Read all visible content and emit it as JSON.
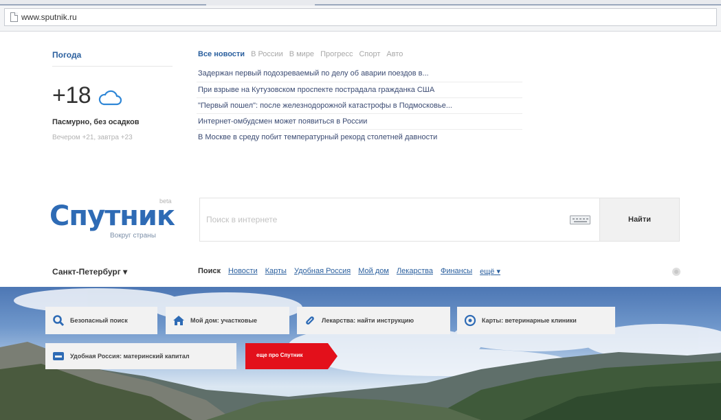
{
  "browser": {
    "url": "www.sputnik.ru"
  },
  "weather": {
    "title": "Погода",
    "temperature": "+18",
    "condition_icon": "cloud-icon",
    "description": "Пасмурно, без осадков",
    "forecast": "Вечером +21, завтра +23"
  },
  "news": {
    "tabs": [
      "Все новости",
      "В России",
      "В мире",
      "Прогресс",
      "Спорт",
      "Авто"
    ],
    "active_tab": "Все новости",
    "items": [
      "Задержан первый подозреваемый по делу об аварии поездов в...",
      "При взрыве на Кутузовском проспекте пострадала гражданка США",
      "\"Первый пошел\": после железнодорожной катастрофы в Подмосковье...",
      "Интернет-омбудсмен может появиться в России",
      "В Москве в среду побит температурный рекорд столетней давности"
    ]
  },
  "logo": {
    "name": "Спутник",
    "badge": "beta",
    "tagline": "Вокруг страны",
    "color": "#2e6bb5"
  },
  "search": {
    "placeholder": "Поиск в интернете",
    "value": "",
    "button_label": "Найти",
    "keyboard_icon": "keyboard-icon"
  },
  "region": {
    "city": "Санкт-Петербург"
  },
  "services": {
    "items": [
      "Поиск",
      "Новости",
      "Карты",
      "Удобная Россия",
      "Мой дом",
      "Лекарства",
      "Финансы",
      "ещё"
    ],
    "active": "Поиск",
    "settings_icon": "gear-icon"
  },
  "banner": {
    "chips": [
      {
        "label": "Безопасный поиск",
        "icon": "search-icon"
      },
      {
        "label": "Мой дом: участковые",
        "icon": "home-icon"
      },
      {
        "label": "Лекарства: найти инструкцию",
        "icon": "pill-icon"
      },
      {
        "label": "Карты: ветеринарные клиники",
        "icon": "map-target-icon"
      },
      {
        "label": "Удобная Россия: материнский капитал",
        "icon": "inbox-icon"
      }
    ],
    "promo": {
      "label": "еще про Спутник",
      "color": "#e3101b"
    }
  },
  "colors": {
    "accent": "#2a5f9e",
    "link": "#3a4a72",
    "muted": "#b2b2b2"
  }
}
